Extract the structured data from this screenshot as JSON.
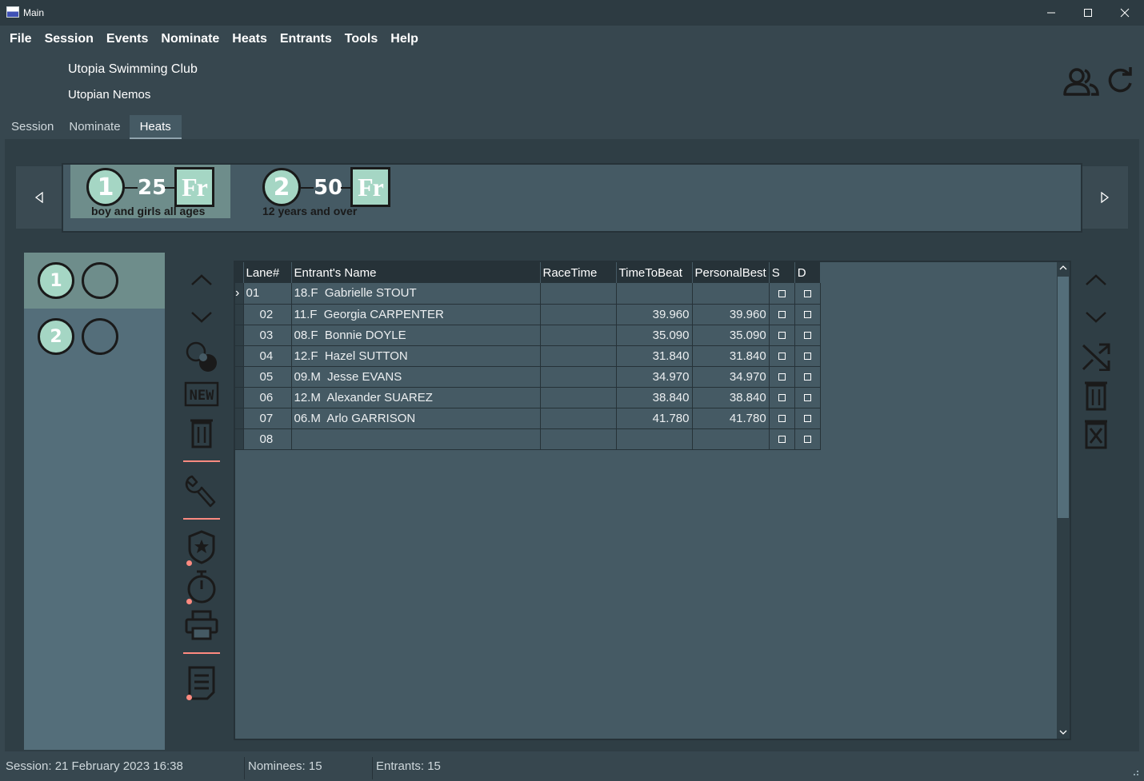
{
  "window": {
    "title": "Main"
  },
  "menu": [
    "File",
    "Session",
    "Events",
    "Nominate",
    "Heats",
    "Entrants",
    "Tools",
    "Help"
  ],
  "club": {
    "name": "Utopia Swimming Club",
    "team": "Utopian Nemos"
  },
  "tabs": [
    {
      "label": "Session",
      "active": false
    },
    {
      "label": "Nominate",
      "active": false
    },
    {
      "label": "Heats",
      "active": true
    }
  ],
  "events": [
    {
      "number": "1",
      "distance": "25",
      "stroke": "Fr",
      "description": "boy and girls all ages",
      "selected": true
    },
    {
      "number": "2",
      "distance": "50",
      "stroke": "Fr",
      "description": "12 years and over",
      "selected": false
    }
  ],
  "heats": [
    {
      "number": "1",
      "selected": true
    },
    {
      "number": "2",
      "selected": false
    }
  ],
  "grid": {
    "columns": [
      "Lane#",
      "Entrant's Name",
      "RaceTime",
      "TimeToBeat",
      "PersonalBest",
      "S",
      "D"
    ],
    "rows": [
      {
        "lane": "01",
        "name": "18.F  Gabrielle STOUT",
        "race": "",
        "ttb": "",
        "pb": "",
        "current": true
      },
      {
        "lane": "02",
        "name": "11.F  Georgia CARPENTER",
        "race": "",
        "ttb": "39.960",
        "pb": "39.960",
        "current": false
      },
      {
        "lane": "03",
        "name": "08.F  Bonnie DOYLE",
        "race": "",
        "ttb": "35.090",
        "pb": "35.090",
        "current": false
      },
      {
        "lane": "04",
        "name": "12.F  Hazel SUTTON",
        "race": "",
        "ttb": "31.840",
        "pb": "31.840",
        "current": false
      },
      {
        "lane": "05",
        "name": "09.M  Jesse EVANS",
        "race": "",
        "ttb": "34.970",
        "pb": "34.970",
        "current": false
      },
      {
        "lane": "06",
        "name": "12.M  Alexander SUAREZ",
        "race": "",
        "ttb": "38.840",
        "pb": "38.840",
        "current": false
      },
      {
        "lane": "07",
        "name": "06.M  Arlo GARRISON",
        "race": "",
        "ttb": "41.780",
        "pb": "41.780",
        "current": false
      },
      {
        "lane": "08",
        "name": "",
        "race": "",
        "ttb": "",
        "pb": "",
        "current": false
      }
    ]
  },
  "status": {
    "session": "Session: 21 February 2023 16:38",
    "nominees": "Nominees: 15",
    "entrants": "Entrants: 15"
  },
  "icons": {
    "left_tools": [
      "chevron-up-icon",
      "chevron-down-icon",
      "circles-icon",
      "new-icon",
      "trash-icon",
      "wrench-icon",
      "badge-star-icon",
      "stopwatch-icon",
      "printer-icon",
      "report-icon"
    ],
    "right_tools": [
      "chevron-up-icon",
      "chevron-down-icon",
      "shuffle-icon",
      "trash-icon",
      "delete-box-icon"
    ],
    "header": [
      "members-icon",
      "refresh-icon"
    ]
  },
  "colors": {
    "accent_teal": "#a5d6c4",
    "selection": "#6e8d8b",
    "separator": "#ff8a80"
  }
}
